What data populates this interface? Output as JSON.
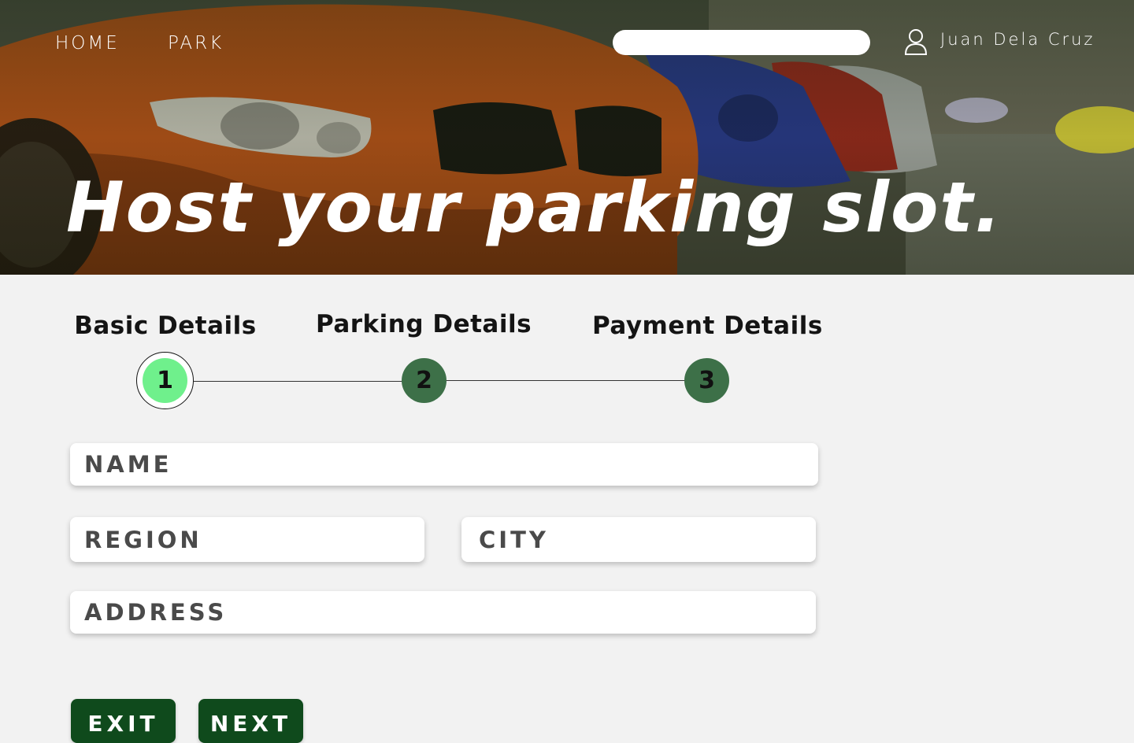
{
  "nav": {
    "links": [
      "HOME",
      "PARK"
    ]
  },
  "search": {
    "value": "",
    "placeholder": ""
  },
  "user": {
    "name": "Juan Dela Cruz",
    "icon": "user-icon"
  },
  "hero": {
    "title": "Host your parking slot."
  },
  "stepper": {
    "active_step": 1,
    "steps": [
      {
        "label": "Basic Details",
        "number": "1"
      },
      {
        "label": "Parking Details",
        "number": "2"
      },
      {
        "label": "Payment Details",
        "number": "3"
      }
    ]
  },
  "form": {
    "name_placeholder": "NAME",
    "region_placeholder": "REGION",
    "city_placeholder": "CITY",
    "address_placeholder": "ADDRESS"
  },
  "actions": {
    "exit_label": "EXIT",
    "next_label": "NEXT"
  },
  "colors": {
    "active_step": "#6ff08c",
    "inactive_step": "#3d7048",
    "button": "#0f4a1c",
    "background": "#f2f2f2"
  }
}
